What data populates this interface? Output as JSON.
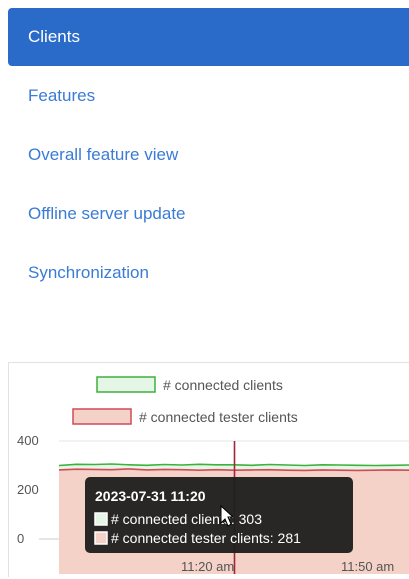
{
  "nav": {
    "items": [
      {
        "label": "Clients",
        "active": true
      },
      {
        "label": "Features",
        "active": false
      },
      {
        "label": "Overall feature view",
        "active": false
      },
      {
        "label": "Offline server update",
        "active": false
      },
      {
        "label": "Synchronization",
        "active": false
      }
    ]
  },
  "colors": {
    "nav_active_bg": "#2a6ac8",
    "nav_link": "#3a7bd5",
    "series_clients_stroke": "#3db03d",
    "series_clients_fill": "#e6f6e6",
    "series_tester_stroke": "#d14a58",
    "series_tester_fill": "#f4d2c8",
    "tooltip_bg": "#1e1e1e"
  },
  "chart_data": {
    "type": "area",
    "legend": {
      "position": "top",
      "entries": [
        "# connected clients",
        "# connected tester clients"
      ]
    },
    "series": [
      {
        "name": "# connected clients",
        "values": [
          300,
          305,
          304,
          306,
          303,
          301,
          304,
          302,
          305,
          303,
          303,
          301,
          304,
          302,
          300,
          303,
          302,
          301,
          300,
          301,
          302
        ]
      },
      {
        "name": "# connected tester clients",
        "values": [
          282,
          285,
          284,
          283,
          286,
          282,
          284,
          283,
          281,
          283,
          281,
          282,
          283,
          281,
          280,
          282,
          281,
          280,
          281,
          282,
          281
        ]
      }
    ],
    "ylim": [
      0,
      420
    ],
    "y_ticks": [
      "400",
      "200",
      "0"
    ],
    "x_ticks": [
      "11:20 am",
      "11:50 am"
    ],
    "grid": true,
    "cursor_index": 10,
    "tooltip": {
      "title": "2023-07-31 11:20",
      "lines": [
        {
          "label": "# connected clients: 303"
        },
        {
          "label": "# connected tester clients: 281"
        }
      ]
    }
  }
}
